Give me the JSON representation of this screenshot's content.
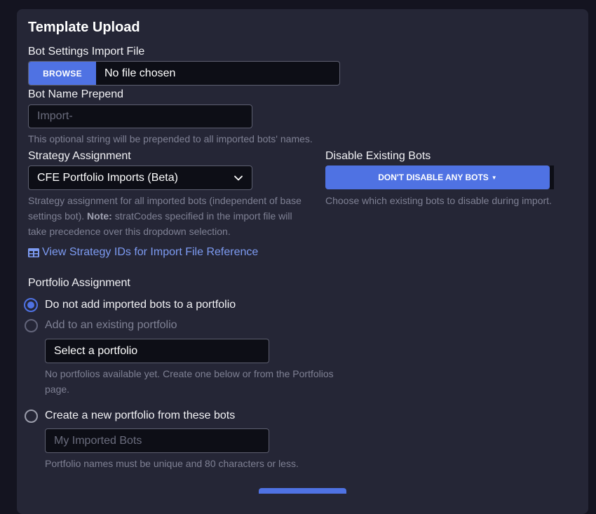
{
  "title": "Template Upload",
  "import_file": {
    "label": "Bot Settings Import File",
    "browse": "BROWSE",
    "file_text": "No file chosen"
  },
  "prepend": {
    "label": "Bot Name Prepend",
    "placeholder": "Import-",
    "help": "This optional string will be prepended to all imported bots' names."
  },
  "strategy": {
    "label": "Strategy Assignment",
    "selected": "CFE Portfolio Imports (Beta)",
    "help_1": "Strategy assignment for all imported bots (independent of base",
    "help_2a": "settings bot). ",
    "help_2_bold": "Note:",
    "help_2b": " stratCodes specified in the import file will",
    "help_3": "take precedence over this dropdown selection.",
    "link": "View Strategy IDs for Import File Reference"
  },
  "disable": {
    "label": "Disable Existing Bots",
    "button": "DON'T DISABLE ANY BOTS",
    "help": "Choose which existing bots to disable during import."
  },
  "portfolio": {
    "label": "Portfolio Assignment",
    "options": [
      {
        "label": "Do not add imported bots to a portfolio",
        "selected": true
      },
      {
        "label": "Add to an existing portfolio",
        "selected": false
      },
      {
        "label": "Create a new portfolio from these bots",
        "selected": false
      }
    ],
    "select_text": "Select a portfolio",
    "select_help_1": "No portfolios available yet. Create one below or from the Portfolios",
    "select_help_2": "page.",
    "new_placeholder": "My Imported Bots",
    "new_help": "Portfolio names must be unique and 80 characters or less."
  },
  "colors": {
    "background": "#141420",
    "card": "#252636",
    "accent": "#4f72e3",
    "link": "#7d9bf2",
    "muted": "#7f8194"
  }
}
